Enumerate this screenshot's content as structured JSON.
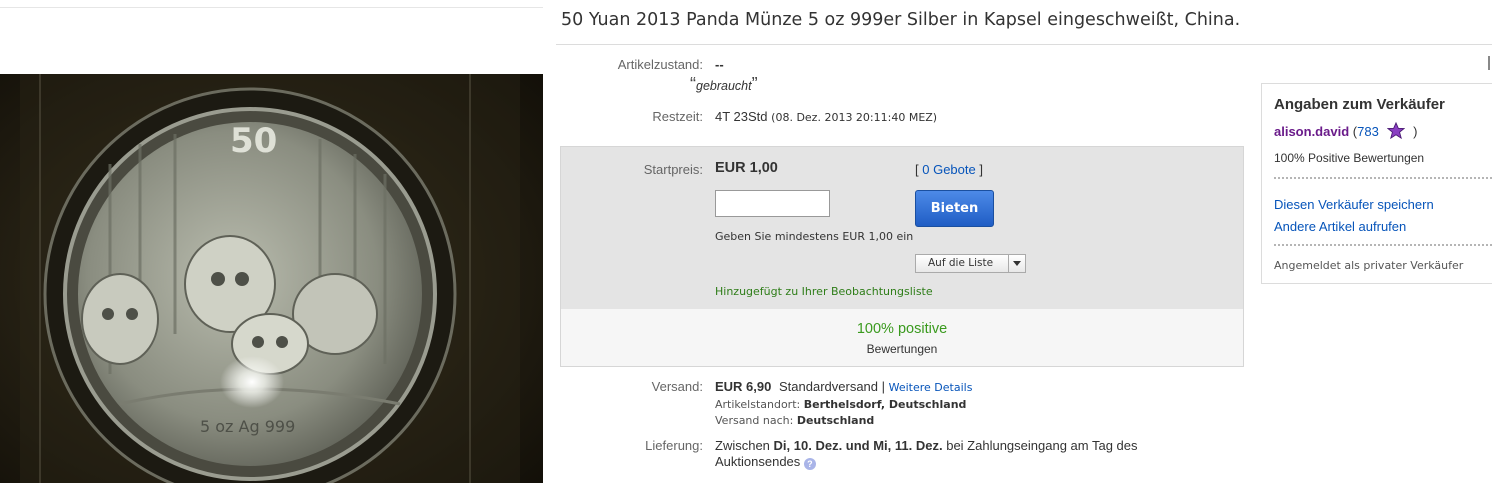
{
  "listing": {
    "title": "50 Yuan 2013 Panda Münze 5 oz 999er Silber in Kapsel eingeschweißt, China."
  },
  "coin": {
    "denomination": "50",
    "inscription": "5 oz Ag 999"
  },
  "condition": {
    "label": "Artikelzustand:",
    "value": "--",
    "quote_open": "“",
    "note": "gebraucht",
    "quote_close": "”"
  },
  "time_left": {
    "label": "Restzeit:",
    "value": "4T 23Std",
    "end_date": "(08. Dez. 2013  20:11:40 MEZ)"
  },
  "bid": {
    "start_label": "Startpreis:",
    "price": "EUR 1,00",
    "bids_open": "[ ",
    "bids_link": "0 Gebote",
    "bids_close": " ]",
    "input_value": "",
    "button_label": "Bieten",
    "hint": "Geben Sie mindestens EUR 1,00 ein",
    "watch_select": "Auf die Liste",
    "watch_added": "Hinzugefügt zu Ihrer Beobachtungsliste"
  },
  "feedback": {
    "percent": "100% positive",
    "label": "Bewertungen"
  },
  "shipping": {
    "label": "Versand:",
    "cost": "EUR 6,90",
    "method": "Standardversand |",
    "details_link": "Weitere Details",
    "location_label": "Artikelstandort:",
    "location": "Berthelsdorf, Deutschland",
    "ships_to_label": "Versand nach:",
    "ships_to": "Deutschland"
  },
  "delivery": {
    "label": "Lieferung:",
    "prefix": "Zwischen",
    "range": "Di, 10. Dez. und Mi, 11. Dez.",
    "suffix": "bei Zahlungseingang am Tag des",
    "line2": "Auktionsendes",
    "help_icon": "?"
  },
  "seller": {
    "heading": "Angaben zum Verkäufer",
    "name": "alison.david",
    "score_open": "(",
    "score": "783",
    "score_close": ")",
    "star_icon": "purple-star-icon",
    "positive": "100% Positive Bewertungen",
    "save_link": "Diesen Verkäufer speichern",
    "other_items_link": "Andere Artikel aufrufen",
    "type": "Angemeldet als privater Verkäufer"
  },
  "colors": {
    "link": "#0654ba",
    "seller_name": "#6a1b8a",
    "positive_green": "#3a9a1e",
    "watch_green": "#2e7d18",
    "bid_button": "#2b6ad6",
    "star": "#8a3fc2"
  }
}
